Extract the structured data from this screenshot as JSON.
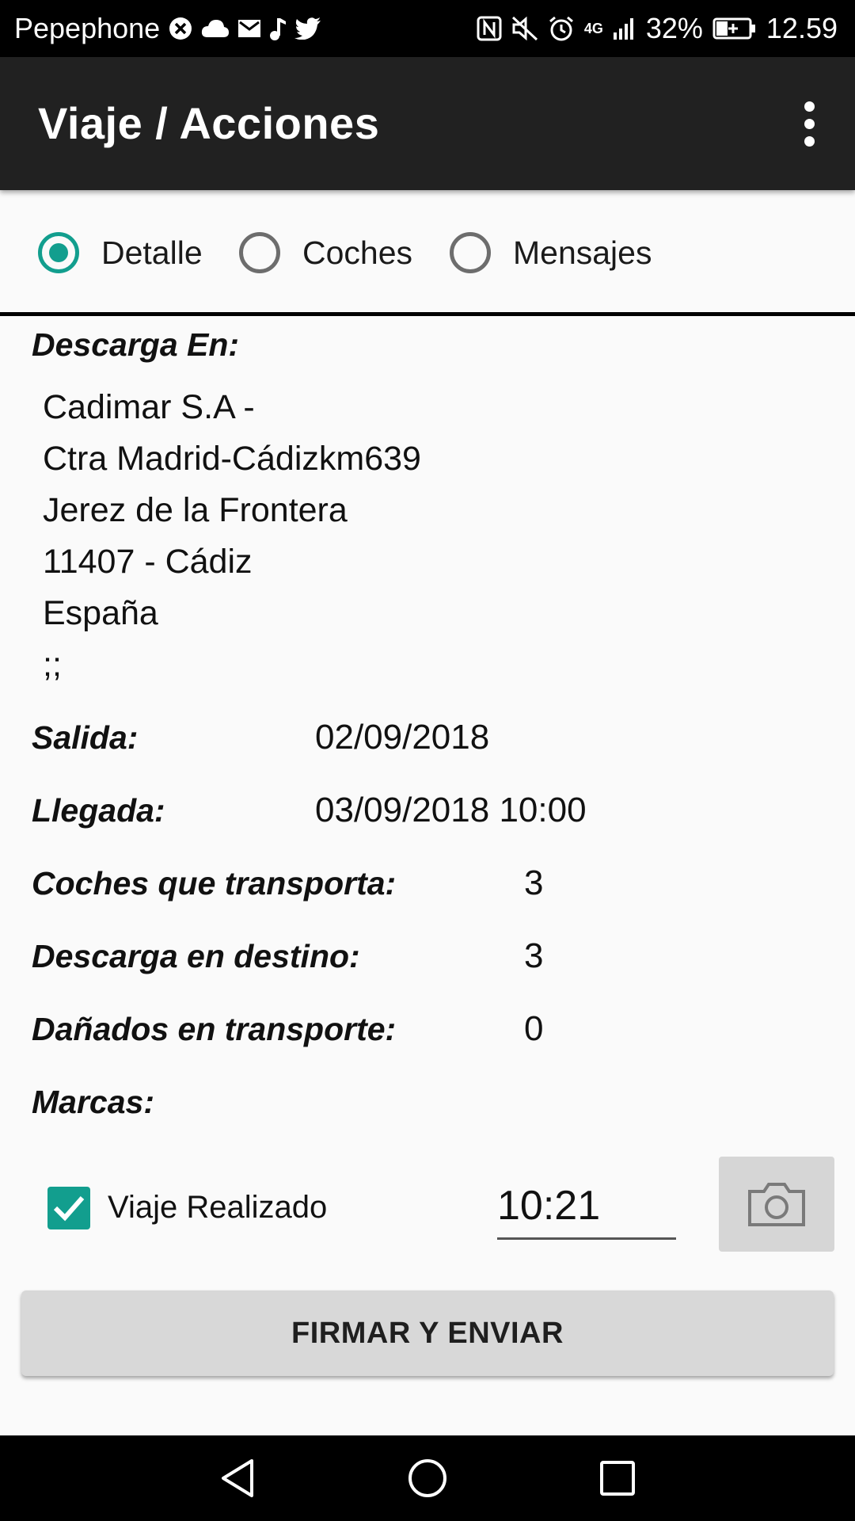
{
  "status_bar": {
    "carrier": "Pepephone",
    "signal": "4G",
    "battery": "32%",
    "time": "12.59"
  },
  "toolbar": {
    "title": "Viaje / Acciones"
  },
  "tabs": [
    {
      "label": "Detalle",
      "checked": true
    },
    {
      "label": "Coches",
      "checked": false
    },
    {
      "label": "Mensajes",
      "checked": false
    }
  ],
  "detail": {
    "unload_label": "Descarga En:",
    "address_lines": [
      "Cadimar S.A -",
      "Ctra Madrid-Cádizkm639",
      "Jerez de la Frontera",
      "11407 - Cádiz",
      "España",
      ";;"
    ],
    "departure_label": "Salida:",
    "departure_value": "02/09/2018",
    "arrival_label": "Llegada:",
    "arrival_value": "03/09/2018 10:00",
    "cars_label": "Coches que transporta:",
    "cars_value": "3",
    "unload_dest_label": "Descarga en destino:",
    "unload_dest_value": "3",
    "damaged_label": "Dañados en transporte:",
    "damaged_value": "0",
    "brands_label": "Marcas:"
  },
  "trip_done": {
    "label": "Viaje Realizado",
    "checked": true,
    "time": "10:21"
  },
  "actions": {
    "send_label": "FIRMAR Y ENVIAR"
  },
  "colors": {
    "accent": "#129e8e",
    "toolbar": "#212121"
  }
}
